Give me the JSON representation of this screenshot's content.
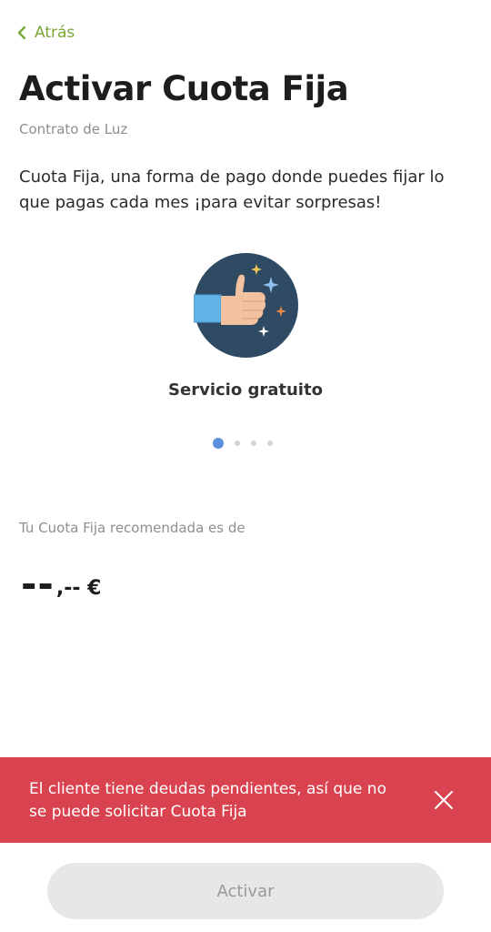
{
  "nav": {
    "back_label": "Atrás"
  },
  "page": {
    "title": "Activar Cuota Fija",
    "subtitle": "Contrato de Luz",
    "description": "Cuota Fija, una forma de pago donde puedes fijar lo que pagas cada mes ¡para evitar sorpresas!"
  },
  "carousel": {
    "slide_label": "Servicio gratuito",
    "slide_icon": "thumbs-up-icon",
    "dot_count": 4,
    "active_index": 0
  },
  "recommendation": {
    "label": "Tu Cuota Fija recomendada es de",
    "amount_integer": "--",
    "amount_decimal": ",-- €"
  },
  "alert": {
    "message": "El cliente tiene deudas pendientes, así que no se puede solicitar Cuota Fija",
    "close_icon": "close-icon"
  },
  "actions": {
    "activate_label": "Activar"
  },
  "colors": {
    "accent": "#7aa63a",
    "alert_bg": "#d9434f",
    "dot_active": "#5b8edc",
    "illustration_bg": "#2f4a63"
  }
}
